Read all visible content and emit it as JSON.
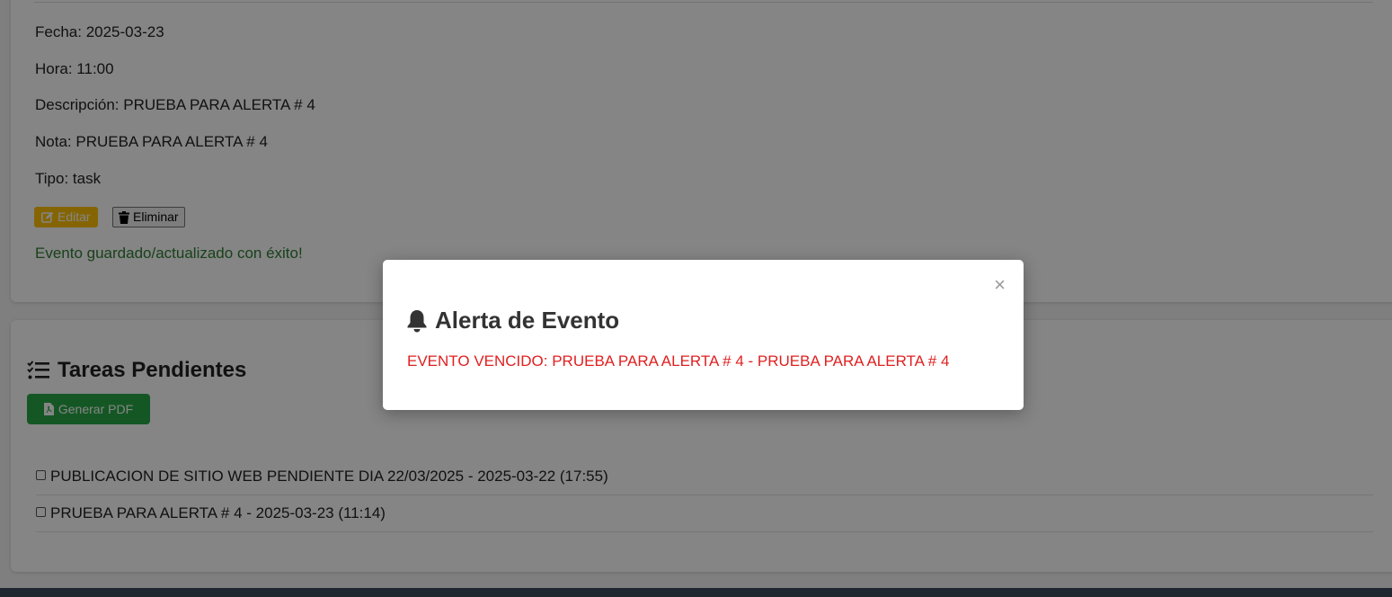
{
  "event_detail": {
    "date": "Fecha: 2025-03-23",
    "time": "Hora: 11:00",
    "description": "Descripción: PRUEBA PARA ALERTA # 4",
    "note": "Nota: PRUEBA PARA ALERTA # 4",
    "type": "Tipo: task",
    "edit_label": "Editar",
    "delete_label": "Eliminar",
    "success_message": "Evento guardado/actualizado con éxito!"
  },
  "tasks": {
    "title": "Tareas Pendientes",
    "pdf_button_label": "Generar PDF",
    "items": [
      {
        "label": "PUBLICACION DE SITIO WEB PENDIENTE DIA 22/03/2025 - 2025-03-22 (17:55)",
        "checked": false
      },
      {
        "label": "PRUEBA PARA ALERTA # 4 - 2025-03-23 (11:14)",
        "checked": false
      }
    ]
  },
  "modal": {
    "close_symbol": "×",
    "title": "Alerta de Evento",
    "message": "EVENTO VENCIDO: PRUEBA PARA ALERTA # 4 - PRUEBA PARA ALERTA # 4"
  },
  "colors": {
    "edit_button": "#ffc107",
    "pdf_button": "#28a745",
    "success_text": "#2e7d32",
    "alert_text": "#e02020",
    "footer": "#3b4a5c"
  },
  "icons": {
    "edit": "edit-icon",
    "delete": "trash-icon",
    "tasks": "task-list-icon",
    "pdf": "pdf-file-icon",
    "alert": "bell-icon",
    "close": "close-icon"
  }
}
